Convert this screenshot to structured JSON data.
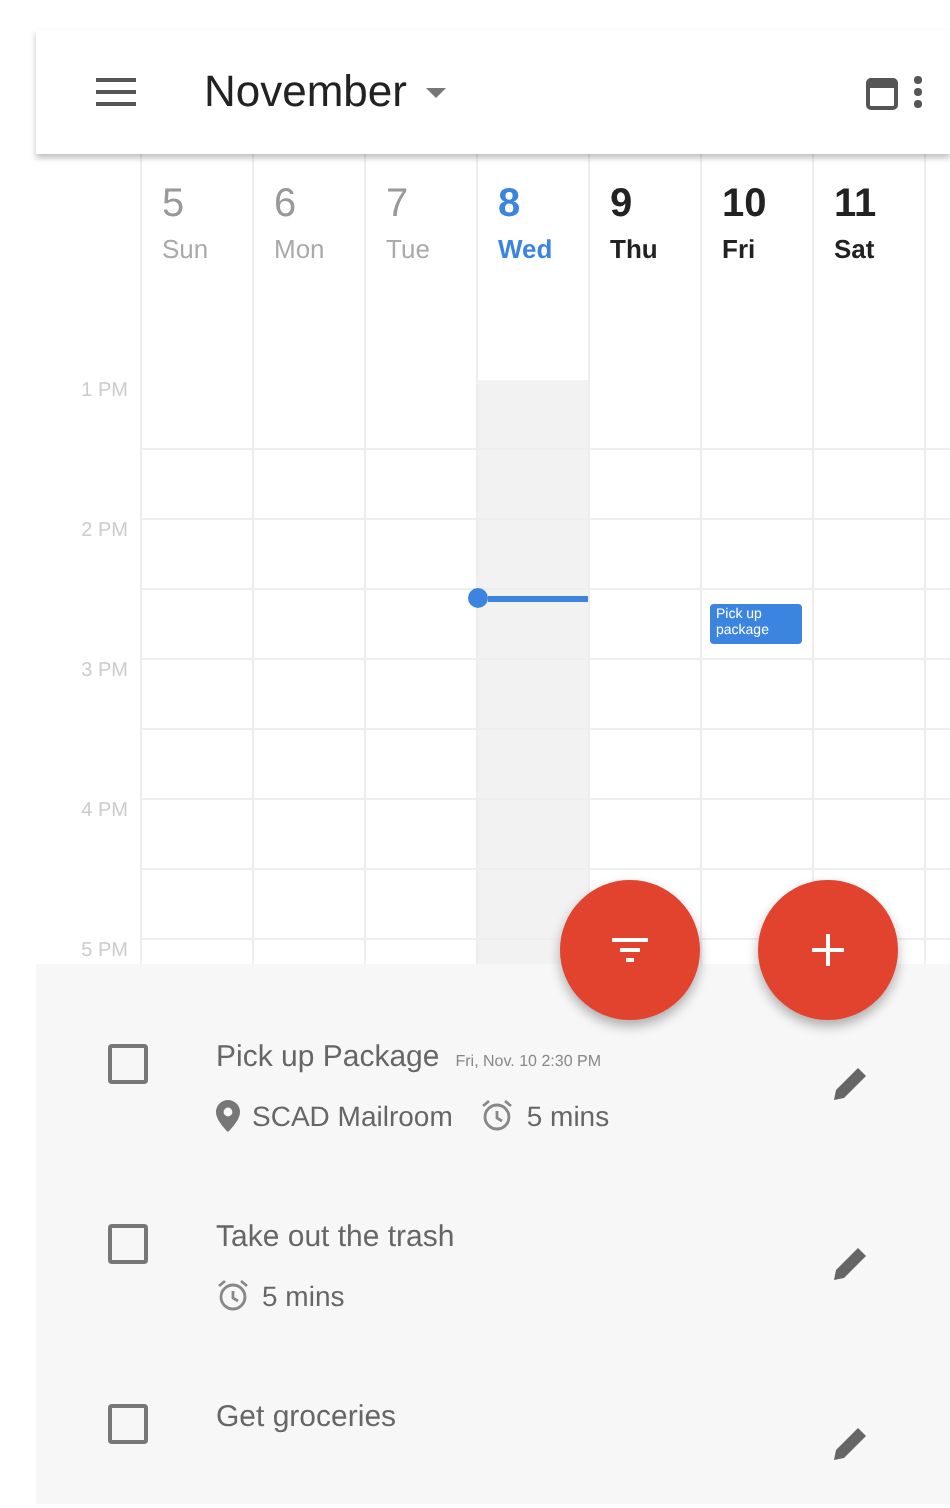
{
  "app_bar": {
    "title": "November"
  },
  "days": [
    {
      "number": "5",
      "weekday": "Sun",
      "past": true,
      "selected": false
    },
    {
      "number": "6",
      "weekday": "Mon",
      "past": true,
      "selected": false
    },
    {
      "number": "7",
      "weekday": "Tue",
      "past": true,
      "selected": false
    },
    {
      "number": "8",
      "weekday": "Wed",
      "past": false,
      "selected": true
    },
    {
      "number": "9",
      "weekday": "Thu",
      "past": false,
      "selected": false
    },
    {
      "number": "10",
      "weekday": "Fri",
      "past": false,
      "selected": false,
      "events": [
        "Pick up package"
      ]
    },
    {
      "number": "11",
      "weekday": "Sat",
      "past": false,
      "selected": false
    }
  ],
  "hours": [
    "1 PM",
    "2 PM",
    "3 PM",
    "4 PM",
    "5 PM"
  ],
  "tasks": [
    {
      "title": "Pick up Package",
      "due": "Fri, Nov. 10 2:30 PM",
      "checked": false,
      "details": [
        {
          "kind": "location",
          "text": "SCAD Mailroom"
        },
        {
          "kind": "duration",
          "text": "5 mins"
        }
      ]
    },
    {
      "title": "Take out the trash",
      "checked": false,
      "details": [
        {
          "kind": "duration",
          "text": "5 mins"
        }
      ]
    },
    {
      "title": "Get groceries",
      "checked": false
    }
  ]
}
